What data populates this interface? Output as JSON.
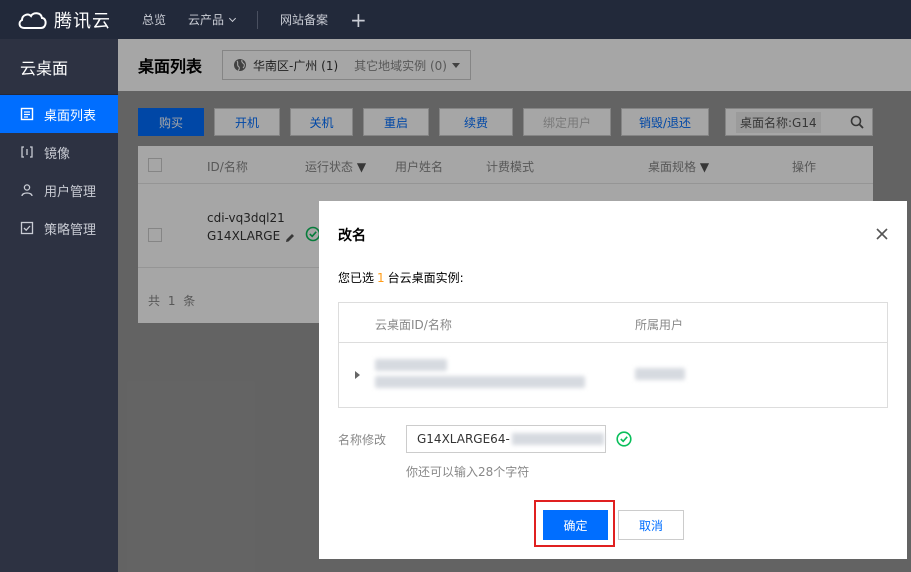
{
  "topnav": {
    "brand": "腾讯云",
    "items": [
      "总览",
      "云产品",
      "网站备案"
    ],
    "plus": "+"
  },
  "sidebar": {
    "title": "云桌面",
    "items": [
      {
        "label": "桌面列表",
        "icon": "list-icon",
        "active": true
      },
      {
        "label": "镜像",
        "icon": "image-icon"
      },
      {
        "label": "用户管理",
        "icon": "user-icon"
      },
      {
        "label": "策略管理",
        "icon": "policy-icon"
      }
    ]
  },
  "page": {
    "title": "桌面列表",
    "region": "华南区-广州 (1)",
    "other_regions": "其它地域实例 (0)"
  },
  "toolbar": {
    "buttons": [
      "购买",
      "开机",
      "关机",
      "重启",
      "续费",
      "绑定用户",
      "销毁/退还"
    ]
  },
  "search": {
    "tag": "桌面名称:",
    "value": "G14"
  },
  "table": {
    "headers": [
      "ID/名称",
      "运行状态",
      "用户姓名",
      "计费模式",
      "桌面规格",
      "操作"
    ],
    "row": {
      "id": "cdi-vq3dql21",
      "name": "G14XLARGE"
    },
    "count": "共 1 条"
  },
  "dialog": {
    "title": "改名",
    "selected_prefix": "您已选",
    "selected_count": "1",
    "selected_suffix": "台云桌面实例:",
    "inner_headers": [
      "云桌面ID/名称",
      "所属用户"
    ],
    "name_label": "名称修改",
    "name_value": "G14XLARGE64-",
    "hint": "你还可以输入28个字符",
    "confirm": "确定",
    "cancel": "取消"
  },
  "colors": {
    "primary": "#006eff",
    "nav_bg": "#22293a",
    "sidebar_bg": "#2d3242",
    "highlight": "#ff9c19",
    "success": "#0abf5b",
    "frame": "#e02020"
  }
}
